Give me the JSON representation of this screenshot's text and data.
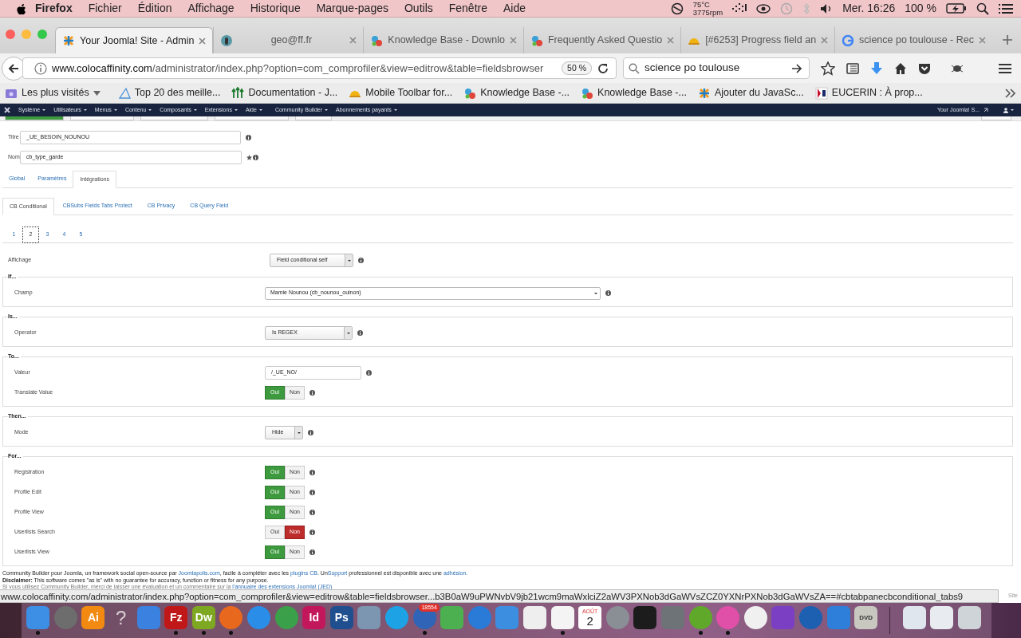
{
  "menubar": {
    "app": "Firefox",
    "menus": [
      "Fichier",
      "Édition",
      "Affichage",
      "Historique",
      "Marque-pages",
      "Outils",
      "Fenêtre",
      "Aide"
    ],
    "temperature": "75°C",
    "fan": "3775rpm",
    "clock": "Mer. 16:26",
    "battery": "100 %"
  },
  "browser": {
    "tabs": [
      {
        "title": "Your Joomla! Site - Admin",
        "selected": true
      },
      {
        "title": "geo@ff.fr",
        "selected": false
      },
      {
        "title": "Knowledge Base - Downlo",
        "selected": false
      },
      {
        "title": "Frequently Asked Questio",
        "selected": false
      },
      {
        "title": "[#6253] Progress field an",
        "selected": false
      },
      {
        "title": "science po toulouse - Rec",
        "selected": false
      }
    ],
    "url": "www.colocaffinity.com/administrator/index.php?option=com_comprofiler&view=editrow&table=fieldsbrowser",
    "zoom": "50 %",
    "search": "science po toulouse",
    "bookmarks": [
      "Les plus visités",
      "Top 20 des meille...",
      "Documentation - J...",
      "Mobile Toolbar for...",
      "Knowledge Base -...",
      "Knowledge Base -...",
      "Ajouter du JavaSc...",
      "EUCERIN : À prop..."
    ]
  },
  "admin_menu": {
    "items": [
      "Système",
      "Utilisateurs",
      "Menus",
      "Contenu",
      "Composants",
      "Extensions",
      "Aide",
      "Community Builder",
      "Abonnements payants"
    ],
    "site": "Your Joomla! S..."
  },
  "form": {
    "fields": [
      {
        "label": "Titre",
        "value": "_UE_BESOIN_NOUNOU",
        "required": false
      },
      {
        "label": "Nom",
        "value": "cb_type_garde",
        "required": true
      }
    ],
    "tabs": [
      {
        "label": "Global",
        "selected": false
      },
      {
        "label": "Paramètres",
        "selected": false
      },
      {
        "label": "Intégrations",
        "selected": true
      }
    ],
    "subtabs": [
      {
        "label": "CB Conditional",
        "selected": true
      },
      {
        "label": "CBSubs Fields Tabs Protect",
        "selected": false
      },
      {
        "label": "CB Privacy",
        "selected": false
      },
      {
        "label": "CB Query Field",
        "selected": false
      }
    ],
    "pages": [
      {
        "label": "1",
        "selected": false
      },
      {
        "label": "2",
        "selected": true
      },
      {
        "label": "3",
        "selected": false
      },
      {
        "label": "4",
        "selected": false
      },
      {
        "label": "5",
        "selected": false
      }
    ],
    "display": {
      "label": "Affichage",
      "kind": "select",
      "value": "Field conditional self"
    },
    "fieldsets": [
      {
        "legend": "If...",
        "rows": [
          {
            "label": "Champ",
            "kind": "native-select",
            "value": "Mamie Nounou (cb_nounou_ouinon)"
          }
        ]
      },
      {
        "legend": "Is...",
        "rows": [
          {
            "label": "Operator",
            "kind": "select",
            "value": "Is REGEX"
          }
        ]
      },
      {
        "legend": "To...",
        "rows": [
          {
            "label": "Valeur",
            "kind": "text",
            "value": "/_UE_NO/"
          },
          {
            "label": "Translate Value",
            "kind": "toggle",
            "options": [
              {
                "label": "Oui",
                "selected": true
              },
              {
                "label": "Non",
                "selected": false
              }
            ]
          }
        ]
      },
      {
        "legend": "Then...",
        "rows": [
          {
            "label": "Mode",
            "kind": "select",
            "value": "Hide"
          }
        ]
      },
      {
        "legend": "For...",
        "rows": [
          {
            "label": "Registration",
            "kind": "toggle",
            "options": [
              {
                "label": "Oui",
                "selected": true
              },
              {
                "label": "Non",
                "selected": false
              }
            ]
          },
          {
            "label": "Profile Edit",
            "kind": "toggle",
            "options": [
              {
                "label": "Oui",
                "selected": true
              },
              {
                "label": "Non",
                "selected": false
              }
            ]
          },
          {
            "label": "Profile View",
            "kind": "toggle",
            "options": [
              {
                "label": "Oui",
                "selected": true
              },
              {
                "label": "Non",
                "selected": false
              }
            ]
          },
          {
            "label": "Userlists Search",
            "kind": "toggle",
            "options": [
              {
                "label": "Oui",
                "selected": false
              },
              {
                "label": "Non",
                "selected": true
              }
            ]
          },
          {
            "label": "Userlists View",
            "kind": "toggle",
            "options": [
              {
                "label": "Oui",
                "selected": true
              },
              {
                "label": "Non",
                "selected": false
              }
            ]
          }
        ]
      }
    ]
  },
  "footer": {
    "credits": [
      {
        "text": "Community Builder pour Joomla, un framework social open-source par ",
        "link": false
      },
      {
        "text": "Joomlapolis.com",
        "link": true
      },
      {
        "text": ", facile à compléter avec les ",
        "link": false
      },
      {
        "text": "plugins CB",
        "link": true
      },
      {
        "text": ". Un",
        "link": false
      },
      {
        "text": "Support",
        "link": true
      },
      {
        "text": " professionnel est disponible avec une ",
        "link": false
      },
      {
        "text": "adhésion.",
        "link": true
      }
    ],
    "disclaimer": "**Disclaimer:** This software comes \"as is\" with no guarantee for accuracy, function or fitness for any purpose.",
    "review": [
      {
        "text": "Si vous utilisez Community Builder, merci de laisser une évaluation et un commentaire sur la ",
        "link": false
      },
      {
        "text": "l'annuaire des extensions Joomla! (JED)",
        "link": true
      }
    ]
  },
  "status_bar": {
    "url": "www.colocaffinity.com/administrator/index.php?option=com_comprofiler&view=editrow&table=fieldsbrowser...b3B0aW9uPWNvbV9jb21wcm9maWxlciZ2aWV3PXNob3dGaWVsZCZ0YXNrPXNob3dGaWVsZA==#cbtabpanecbconditional_tabs9",
    "side": "Site"
  },
  "dock": [
    {
      "kind": "square",
      "color": "#3d8fe6",
      "running": true
    },
    {
      "kind": "round",
      "color": "#6d6d6d",
      "running": false
    },
    {
      "kind": "square",
      "color": "#f28a12",
      "label": "Ai",
      "running": false
    },
    {
      "kind": "glyph",
      "color": "#d8d0d4",
      "label": "?",
      "running": false
    },
    {
      "kind": "square",
      "color": "#3b82e0",
      "running": false
    },
    {
      "kind": "square",
      "color": "#c01818",
      "label": "Fz",
      "running": true
    },
    {
      "kind": "square",
      "color": "#7ea822",
      "label": "Dw",
      "running": true
    },
    {
      "kind": "round",
      "color": "#e8681e",
      "running": true
    },
    {
      "kind": "round",
      "color": "#2a8ee8",
      "running": false
    },
    {
      "kind": "round",
      "color": "#3aa04a",
      "running": false
    },
    {
      "kind": "square",
      "color": "#c2185b",
      "label": "Id",
      "running": false
    },
    {
      "kind": "square",
      "color": "#1f4f8e",
      "label": "Ps",
      "running": false
    },
    {
      "kind": "square",
      "color": "#7c95b0",
      "running": false
    },
    {
      "kind": "round",
      "color": "#1da2e6",
      "running": false
    },
    {
      "kind": "round",
      "color": "#2f64b6",
      "badge": "18554",
      "running": true
    },
    {
      "kind": "square",
      "color": "#4caf50",
      "running": false
    },
    {
      "kind": "round",
      "color": "#2a7ad8",
      "running": false
    },
    {
      "kind": "square",
      "color": "#3b8ee0",
      "running": false
    },
    {
      "kind": "square",
      "color": "#eeeeee",
      "running": false
    },
    {
      "kind": "square",
      "color": "#f4f4f4",
      "running": true
    },
    {
      "kind": "calendar",
      "color": "#ffffff",
      "month": "AOÛT",
      "day": "2",
      "running": false
    },
    {
      "kind": "round",
      "color": "#8a8f96",
      "running": false
    },
    {
      "kind": "square",
      "color": "#1c1c1c",
      "running": false
    },
    {
      "kind": "square",
      "color": "#6e7378",
      "running": false
    },
    {
      "kind": "round",
      "color": "#5fa82a",
      "running": true
    },
    {
      "kind": "round",
      "color": "#e04fa8",
      "running": true
    },
    {
      "kind": "round",
      "color": "#f0f0f0",
      "running": false
    },
    {
      "kind": "square",
      "color": "#7b3fc4",
      "running": false
    },
    {
      "kind": "round",
      "color": "#1d5fb0",
      "running": false
    },
    {
      "kind": "square",
      "color": "#2e7fd9",
      "running": false
    },
    {
      "kind": "square",
      "color": "#c8c8c0",
      "label": "DVD",
      "running": false
    },
    {
      "kind": "separator",
      "color": "#3a2a3a"
    },
    {
      "kind": "square",
      "color": "#dfe6ee",
      "running": false
    },
    {
      "kind": "square",
      "color": "#e8ecf0",
      "running": false
    },
    {
      "kind": "square",
      "color": "#cfd4d8",
      "running": false
    }
  ]
}
